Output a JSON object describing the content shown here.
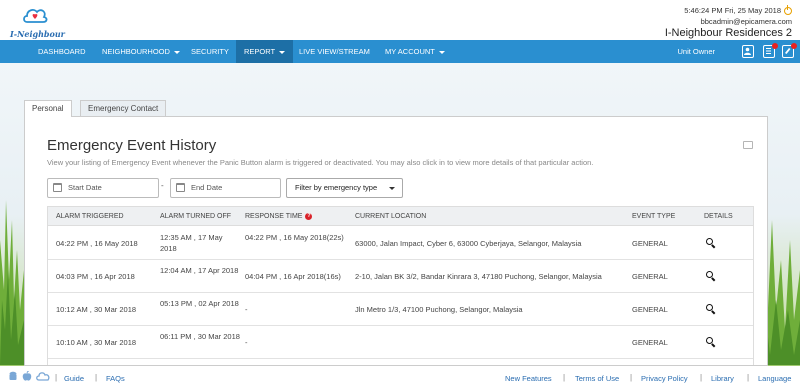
{
  "header": {
    "logo_text": "I-Neighbour",
    "datetime": "5:46:24 PM  Fri, 25 May 2018",
    "email": "bbcadmin@epicamera.com",
    "site_name": "I-Neighbour Residences 2"
  },
  "nav": {
    "items": [
      {
        "label": "DASHBOARD",
        "dropdown": false
      },
      {
        "label": "NEIGHBOURHOOD",
        "dropdown": true
      },
      {
        "label": "SECURITY",
        "dropdown": false
      },
      {
        "label": "REPORT",
        "dropdown": true,
        "active": true
      },
      {
        "label": "LIVE VIEW/STREAM",
        "dropdown": false
      },
      {
        "label": "MY ACCOUNT",
        "dropdown": true
      }
    ],
    "role": "Unit Owner",
    "icons": [
      "profile-icon",
      "document-icon",
      "notes-icon"
    ],
    "accent": "#2a8fd0",
    "active_color": "#1d6fa6"
  },
  "tabs": [
    "Personal",
    "Emergency Contact"
  ],
  "page": {
    "title": "Emergency Event History",
    "description": "View your listing of Emergency Event whenever the Panic Button alarm is triggered or deactivated. You may also click in to view more details of that particular action.",
    "start_date_placeholder": "Start Date",
    "dash": "-",
    "end_date_placeholder": "End Date",
    "filter_label": "Filter by emergency type"
  },
  "table": {
    "headers": [
      "ALARM TRIGGERED",
      "ALARM TURNED OFF",
      "RESPONSE TIME",
      "CURRENT LOCATION",
      "EVENT TYPE",
      "DETAILS"
    ],
    "rows": [
      {
        "triggered": "04:22 PM , 16 May 2018",
        "turned_off": "12:35 AM , 17 May 2018",
        "response": "04:22 PM , 16 May 2018(22s)",
        "location": "63000, Jalan Impact, Cyber 6, 63000 Cyberjaya, Selangor, Malaysia",
        "type": "GENERAL"
      },
      {
        "triggered": "04:03 PM , 16 Apr 2018",
        "turned_off": "12:04 AM , 17 Apr 2018",
        "response": "04:04 PM , 16 Apr 2018(16s)",
        "location": "2-10, Jalan BK 3/2, Bandar Kinrara 3, 47180 Puchong, Selangor, Malaysia",
        "type": "GENERAL"
      },
      {
        "triggered": "10:12 AM , 30 Mar 2018",
        "turned_off": "05:13 PM , 02 Apr 2018",
        "response": "-",
        "location": "Jln Metro 1/3, 47100 Puchong, Selangor, Malaysia",
        "type": "GENERAL"
      },
      {
        "triggered": "10:10 AM , 30 Mar 2018",
        "turned_off": "06:11 PM , 30 Mar 2018",
        "response": "-",
        "location": "",
        "type": "GENERAL"
      }
    ]
  },
  "footer": {
    "left_links": [
      "Guide",
      "FAQs"
    ],
    "right_links": [
      "New Features",
      "Terms of Use",
      "Privacy Policy",
      "Library",
      "Language"
    ],
    "separator": "|",
    "icons": [
      "android-icon",
      "apple-icon",
      "cloud-icon"
    ]
  }
}
